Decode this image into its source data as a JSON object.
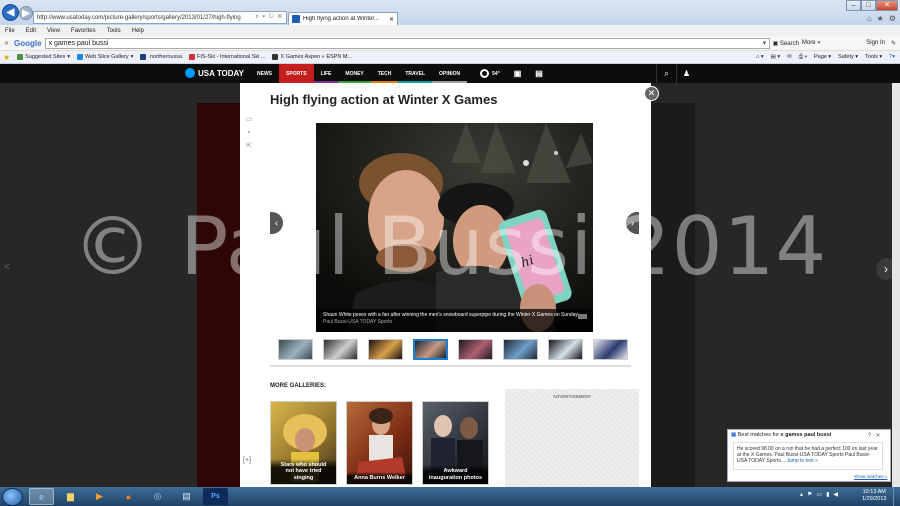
{
  "browser": {
    "url": "http://www.usatoday.com/picture-gallery/sports/gallery/2013/01/27/high-flying",
    "tab_title": "High flying action at Winter...",
    "menu": [
      "File",
      "Edit",
      "View",
      "Favorites",
      "Tools",
      "Help"
    ],
    "google_toolbar": {
      "logo": "Google",
      "query": "x games paul bussi",
      "search_label": "Search",
      "more_label": "More »",
      "sign_in": "Sign In"
    },
    "favorites": [
      "Suggested Sites",
      "Web Slice Gallery",
      ".northernussa",
      "FIS-Ski - International Ski ...",
      "X Games Aspen « ESPN M..."
    ],
    "command_bar": [
      "Page",
      "Safety",
      "Tools"
    ]
  },
  "site": {
    "logo": "USA TODAY",
    "nav": [
      {
        "label": "NEWS",
        "color": "#0d0d0d",
        "bar": ""
      },
      {
        "label": "SPORTS",
        "color": "#c41e1e",
        "bar": "#c41e1e"
      },
      {
        "label": "LIFE",
        "color": "#0d0d0d",
        "bar": "#7b2fa0"
      },
      {
        "label": "MONEY",
        "color": "#0d0d0d",
        "bar": "#3c9d3c"
      },
      {
        "label": "TECH",
        "color": "#0d0d0d",
        "bar": "#e07a00"
      },
      {
        "label": "TRAVEL",
        "color": "#0d0d0d",
        "bar": "#00a5a5"
      },
      {
        "label": "OPINION",
        "color": "#0d0d0d",
        "bar": "#9aa0a6"
      }
    ],
    "weather": "54°"
  },
  "gallery": {
    "title": "High flying action at Winter X Games",
    "caption": "Shaun White poses with a fan after winning the men's snowboard superpipe during the Winter X Games on Sunday.",
    "credit": "Paul Bussi-USA TODAY Sports",
    "thumbnail_count": 8,
    "selected_thumbnail": 4,
    "more_label": "MORE GALLERIES:",
    "more": [
      {
        "label": "Stars who should not have tried singing"
      },
      {
        "label": "Anna Burns Welker"
      },
      {
        "label": "Awkward inauguration photos"
      }
    ],
    "ad_label": "ADVERTISEMENT"
  },
  "watermark": "© Paul Bussi 2014",
  "notification": {
    "heading_prefix": "Best matches for",
    "heading_query": "x games paul bussi",
    "body": "He scored 98.00 on a run that he had a perfect 100 on last year at the X Games. Paul Bussi-USA TODAY Sports Paul Bussi-USA TODAY Sports...",
    "jump": "Jump to text »",
    "more": "Show matches »"
  },
  "taskbar": {
    "time": "10:13 AM",
    "date": "1/29/2013"
  }
}
